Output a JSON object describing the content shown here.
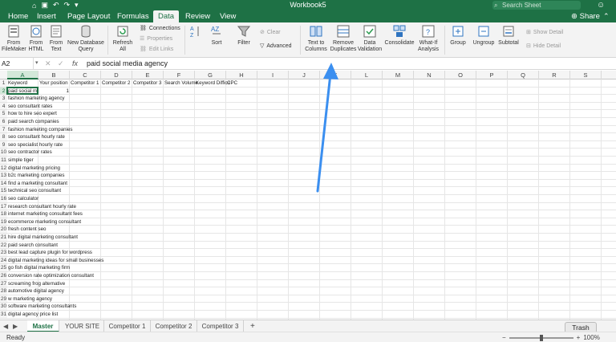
{
  "window": {
    "title": "Workbook5",
    "search_placeholder": "Search Sheet"
  },
  "ribbon_tabs": [
    "Home",
    "Insert",
    "Page Layout",
    "Formulas",
    "Data",
    "Review",
    "View"
  ],
  "active_tab": "Data",
  "share_label": "Share",
  "ribbon": {
    "from_filemaker": "From FileMaker",
    "from_html": "From HTML",
    "from_text": "From Text",
    "new_database_query": "New Database Query",
    "refresh_all": "Refresh All",
    "connections": "Connections",
    "properties": "Properties",
    "edit_links": "Edit Links",
    "sort_az": "A→Z",
    "sort": "Sort",
    "filter": "Filter",
    "clear": "Clear",
    "advanced": "Advanced",
    "text_to_columns": "Text to Columns",
    "remove_duplicates": "Remove Duplicates",
    "data_validation": "Data Validation",
    "consolidate": "Consolidate",
    "what_if_analysis": "What-If Analysis",
    "group": "Group",
    "ungroup": "Ungroup",
    "subtotal": "Subtotal",
    "show_detail": "Show Detail",
    "hide_detail": "Hide Detail"
  },
  "formula_bar": {
    "name_box": "A2",
    "fx": "fx",
    "value": "paid social media agency"
  },
  "columns": [
    "A",
    "B",
    "C",
    "D",
    "E",
    "F",
    "G",
    "H",
    "I",
    "J",
    "K",
    "L",
    "M",
    "N",
    "O",
    "P",
    "Q",
    "R",
    "S"
  ],
  "headers": [
    "Keyword",
    "Your position",
    "Competitor 1",
    "Competitor 2",
    "Competitor 3",
    "Search Volume",
    "Keyword Difficu",
    "CPC"
  ],
  "rows": [
    {
      "n": "1",
      "a": "Keyword",
      "b": ""
    },
    {
      "n": "2",
      "a": "paid social med",
      "b": "1"
    },
    {
      "n": "3",
      "a": "fashion marketing agency",
      "b": ""
    },
    {
      "n": "4",
      "a": "seo consultant rates",
      "b": ""
    },
    {
      "n": "5",
      "a": "how to hire seo expert",
      "b": ""
    },
    {
      "n": "6",
      "a": "paid search companies",
      "b": ""
    },
    {
      "n": "7",
      "a": "fashion marketing companies",
      "b": ""
    },
    {
      "n": "8",
      "a": "seo consultant hourly rate",
      "b": ""
    },
    {
      "n": "9",
      "a": "seo specialist hourly rate",
      "b": ""
    },
    {
      "n": "10",
      "a": "seo contractor rates",
      "b": ""
    },
    {
      "n": "11",
      "a": "simple tiger",
      "b": ""
    },
    {
      "n": "12",
      "a": "digital marketing pricing",
      "b": ""
    },
    {
      "n": "13",
      "a": "b2c marketing companies",
      "b": ""
    },
    {
      "n": "14",
      "a": "find a marketing consultant",
      "b": ""
    },
    {
      "n": "15",
      "a": "technical seo consultant",
      "b": ""
    },
    {
      "n": "16",
      "a": "seo calculator",
      "b": ""
    },
    {
      "n": "17",
      "a": "research consultant hourly rate",
      "b": ""
    },
    {
      "n": "18",
      "a": "internet marketing consultant fees",
      "b": ""
    },
    {
      "n": "19",
      "a": "ecommerce marketing consultant",
      "b": ""
    },
    {
      "n": "20",
      "a": "fresh content seo",
      "b": ""
    },
    {
      "n": "21",
      "a": "hire digital marketing consultant",
      "b": ""
    },
    {
      "n": "22",
      "a": "paid search consultant",
      "b": ""
    },
    {
      "n": "23",
      "a": "best lead capture plugin for wordpress",
      "b": ""
    },
    {
      "n": "24",
      "a": "digital marketing ideas for small businesses",
      "b": ""
    },
    {
      "n": "25",
      "a": "go fish digital marketing firm",
      "b": ""
    },
    {
      "n": "26",
      "a": "conversion rate optimization consultant",
      "b": ""
    },
    {
      "n": "27",
      "a": "screaming frog alternative",
      "b": ""
    },
    {
      "n": "28",
      "a": "automotive digital agency",
      "b": ""
    },
    {
      "n": "29",
      "a": "w marketing agency",
      "b": ""
    },
    {
      "n": "30",
      "a": "software marketing consultants",
      "b": ""
    },
    {
      "n": "31",
      "a": "digital agency price list",
      "b": ""
    }
  ],
  "sheet_tabs": [
    "Master",
    "YOUR SITE",
    "Competitor 1",
    "Competitor 2",
    "Competitor 3"
  ],
  "active_sheet": "Master",
  "add_sheet": "+",
  "status": {
    "text": "Ready",
    "zoom": "100%",
    "zoom_minus": "−",
    "zoom_plus": "+"
  },
  "tooltip": "Trash",
  "colors": {
    "excel_green": "#1e7145",
    "annotation_arrow": "#3b8ff0"
  }
}
